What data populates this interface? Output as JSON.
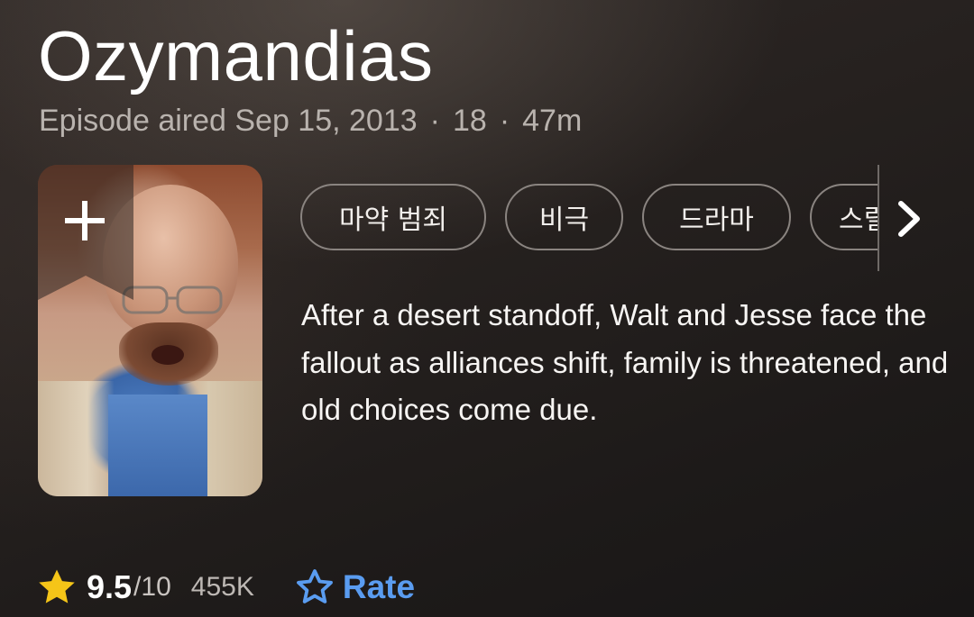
{
  "episode": {
    "title": "Ozymandias",
    "aired_label": "Episode aired Sep 15, 2013",
    "separator": "·",
    "age_rating": "18",
    "runtime": "47m",
    "description": "After a desert standoff, Walt and Jesse face the fallout as alliances shift, family is threatened, and old choices come due."
  },
  "poster": {
    "add_icon": "plus-icon",
    "bookmark_color": "#2a2523"
  },
  "genres": {
    "chips": [
      "마약 범죄",
      "비극",
      "드라마",
      "스릴"
    ],
    "next_icon": "chevron-right-icon"
  },
  "rating": {
    "score": "9.5",
    "max": "/10",
    "votes": "455K",
    "star_icon": "star-filled-icon",
    "star_color": "#f5c518"
  },
  "rate": {
    "label": "Rate",
    "icon": "star-outline-icon",
    "color": "#5a9cf0"
  }
}
